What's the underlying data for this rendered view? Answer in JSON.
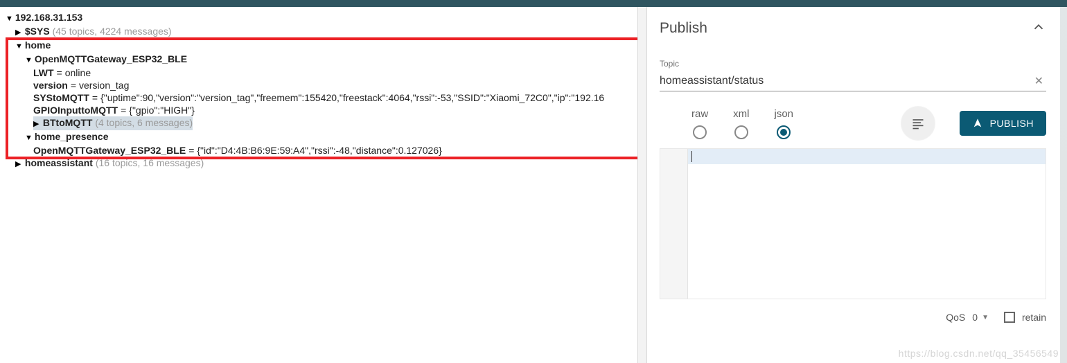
{
  "tree": {
    "root_ip": "192.168.31.153",
    "sys": {
      "label": "$SYS",
      "meta": "(45 topics, 4224 messages)"
    },
    "home": {
      "label": "home",
      "gateway": {
        "label": "OpenMQTTGateway_ESP32_BLE",
        "lwt": {
          "key": "LWT",
          "value": "online"
        },
        "version": {
          "key": "version",
          "value": "version_tag"
        },
        "systomqtt": {
          "key": "SYStoMQTT",
          "value": "{\"uptime\":90,\"version\":\"version_tag\",\"freemem\":155420,\"freestack\":4064,\"rssi\":-53,\"SSID\":\"Xiaomi_72C0\",\"ip\":\"192.16"
        },
        "gpio": {
          "key": "GPIOInputtoMQTT",
          "value": "{\"gpio\":\"HIGH\"}"
        },
        "bttomqtt": {
          "label": "BTtoMQTT",
          "meta": "(4 topics, 6 messages)"
        }
      },
      "presence": {
        "label": "home_presence",
        "gw": {
          "key": "OpenMQTTGateway_ESP32_BLE",
          "value": "{\"id\":\"D4:4B:B6:9E:59:A4\",\"rssi\":-48,\"distance\":0.127026}"
        }
      }
    },
    "homeassistant": {
      "label": "homeassistant",
      "meta": "(16 topics, 16 messages)"
    }
  },
  "publish": {
    "title": "Publish",
    "topic_label": "Topic",
    "topic_value": "homeassistant/status",
    "formats": {
      "raw": "raw",
      "xml": "xml",
      "json": "json"
    },
    "selected_format": "json",
    "publish_button": "PUBLISH",
    "qos_label": "QoS",
    "qos_value": "0",
    "retain_label": "retain"
  },
  "watermark": "https://blog.csdn.net/qq_35456549"
}
